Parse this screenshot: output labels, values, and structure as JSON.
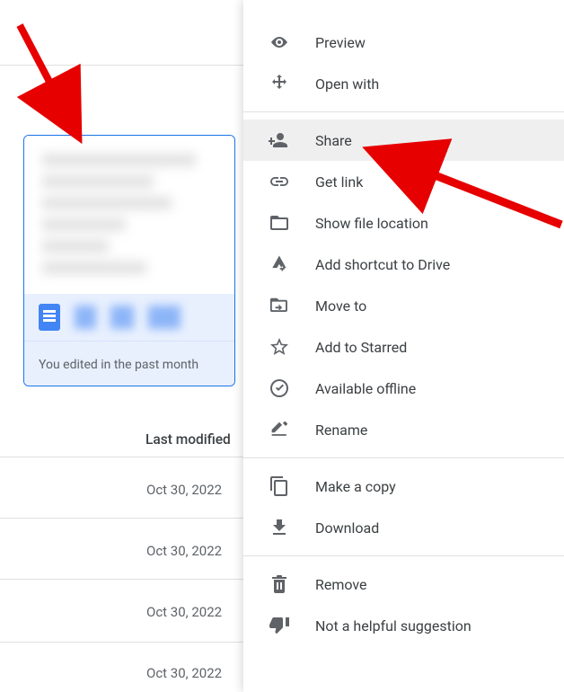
{
  "file_card": {
    "footer_text": "You edited in the past month"
  },
  "list": {
    "column_header": "Last modified",
    "dates": [
      "Oct 30, 2022",
      "Oct 30, 2022",
      "Oct 30, 2022",
      "Oct 30, 2022"
    ]
  },
  "menu": {
    "preview": "Preview",
    "open_with": "Open with",
    "share": "Share",
    "get_link": "Get link",
    "show_location": "Show file location",
    "add_shortcut": "Add shortcut to Drive",
    "move_to": "Move to",
    "starred": "Add to Starred",
    "offline": "Available offline",
    "rename": "Rename",
    "make_copy": "Make a copy",
    "download": "Download",
    "remove": "Remove",
    "not_helpful": "Not a helpful suggestion"
  }
}
